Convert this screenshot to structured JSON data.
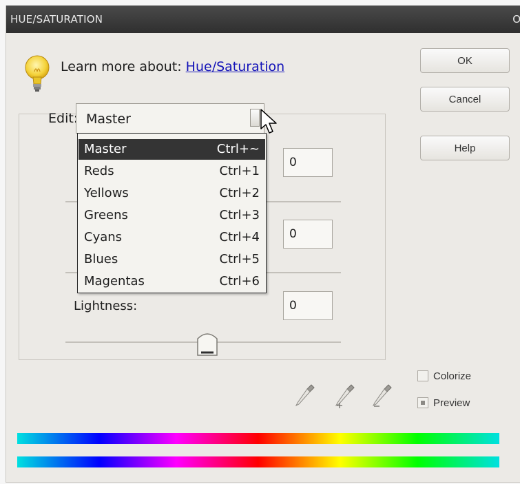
{
  "window": {
    "title": "HUE/SATURATION",
    "close_glyph": "O"
  },
  "learn_more": {
    "prefix": "Learn more about:",
    "link": "Hue/Saturation"
  },
  "buttons": {
    "ok": "OK",
    "cancel": "Cancel",
    "help": "Help"
  },
  "edit": {
    "label": "Edit:",
    "value": "Master",
    "options": [
      {
        "label": "Master",
        "shortcut": "Ctrl+~",
        "selected": true
      },
      {
        "label": "Reds",
        "shortcut": "Ctrl+1"
      },
      {
        "label": "Yellows",
        "shortcut": "Ctrl+2"
      },
      {
        "label": "Greens",
        "shortcut": "Ctrl+3"
      },
      {
        "label": "Cyans",
        "shortcut": "Ctrl+4"
      },
      {
        "label": "Blues",
        "shortcut": "Ctrl+5"
      },
      {
        "label": "Magentas",
        "shortcut": "Ctrl+6"
      }
    ]
  },
  "fields": {
    "hue": "0",
    "saturation": "0",
    "lightness": "0"
  },
  "labels": {
    "lightness": "Lightness:"
  },
  "options": {
    "colorize": "Colorize",
    "preview": "Preview"
  },
  "icons": [
    "lightbulb-icon",
    "eyedropper-icon",
    "eyedropper-plus-icon",
    "eyedropper-minus-icon",
    "mouse-cursor-icon"
  ]
}
